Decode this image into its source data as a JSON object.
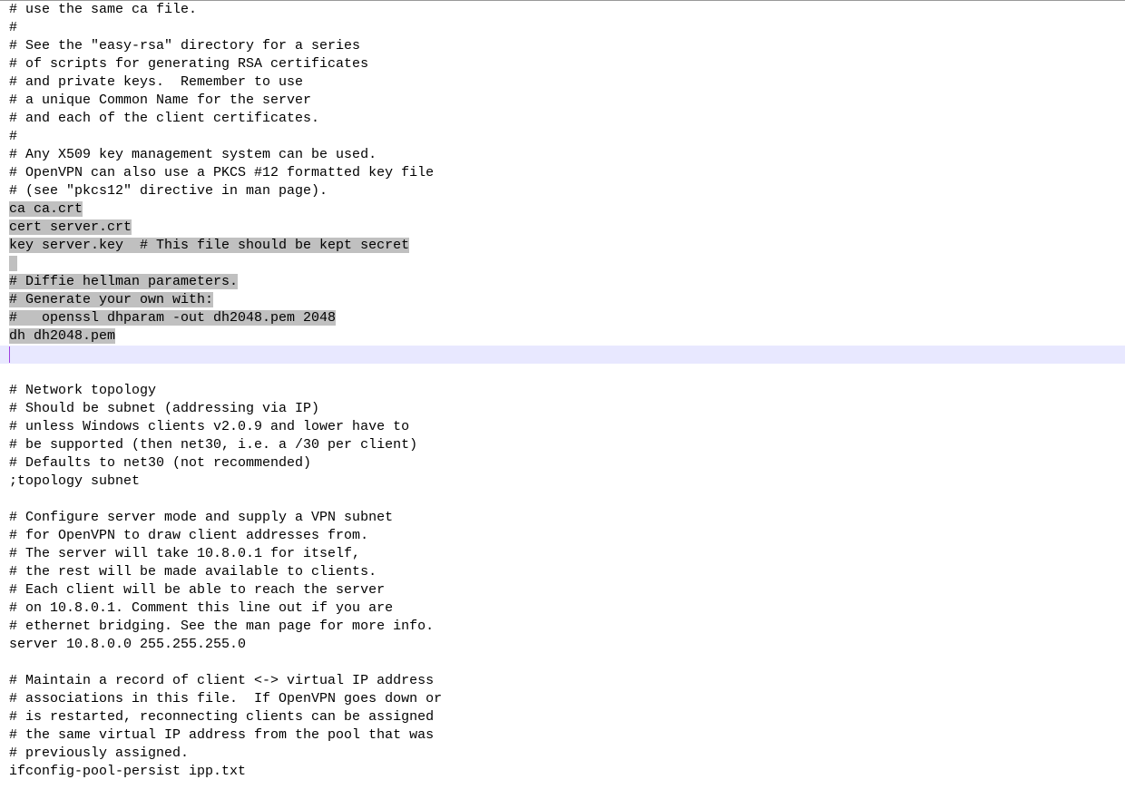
{
  "lines": [
    {
      "t": "# use the same ca file.",
      "sel": false
    },
    {
      "t": "#",
      "sel": false
    },
    {
      "t": "# See the \"easy-rsa\" directory for a series",
      "sel": false
    },
    {
      "t": "# of scripts for generating RSA certificates",
      "sel": false
    },
    {
      "t": "# and private keys.  Remember to use",
      "sel": false
    },
    {
      "t": "# a unique Common Name for the server",
      "sel": false
    },
    {
      "t": "# and each of the client certificates.",
      "sel": false
    },
    {
      "t": "#",
      "sel": false
    },
    {
      "t": "# Any X509 key management system can be used.",
      "sel": false
    },
    {
      "t": "# OpenVPN can also use a PKCS #12 formatted key file",
      "sel": false
    },
    {
      "t": "# (see \"pkcs12\" directive in man page).",
      "sel": false
    },
    {
      "t": "ca ca.crt",
      "sel": true
    },
    {
      "t": "cert server.crt",
      "sel": true
    },
    {
      "t": "key server.key  # This file should be kept secret",
      "sel": true
    },
    {
      "t": " ",
      "sel": true
    },
    {
      "t": "# Diffie hellman parameters.",
      "sel": true
    },
    {
      "t": "# Generate your own with:",
      "sel": true
    },
    {
      "t": "#   openssl dhparam -out dh2048.pem 2048",
      "sel": true
    },
    {
      "t": "dh dh2048.pem",
      "sel": true
    },
    {
      "t": "",
      "sel": false,
      "cursor": true
    },
    {
      "t": "",
      "sel": false
    },
    {
      "t": "# Network topology",
      "sel": false
    },
    {
      "t": "# Should be subnet (addressing via IP)",
      "sel": false
    },
    {
      "t": "# unless Windows clients v2.0.9 and lower have to",
      "sel": false
    },
    {
      "t": "# be supported (then net30, i.e. a /30 per client)",
      "sel": false
    },
    {
      "t": "# Defaults to net30 (not recommended)",
      "sel": false
    },
    {
      "t": ";topology subnet",
      "sel": false
    },
    {
      "t": "",
      "sel": false
    },
    {
      "t": "# Configure server mode and supply a VPN subnet",
      "sel": false
    },
    {
      "t": "# for OpenVPN to draw client addresses from.",
      "sel": false
    },
    {
      "t": "# The server will take 10.8.0.1 for itself,",
      "sel": false
    },
    {
      "t": "# the rest will be made available to clients.",
      "sel": false
    },
    {
      "t": "# Each client will be able to reach the server",
      "sel": false
    },
    {
      "t": "# on 10.8.0.1. Comment this line out if you are",
      "sel": false
    },
    {
      "t": "# ethernet bridging. See the man page for more info.",
      "sel": false
    },
    {
      "t": "server 10.8.0.0 255.255.255.0",
      "sel": false
    },
    {
      "t": "",
      "sel": false
    },
    {
      "t": "# Maintain a record of client <-> virtual IP address",
      "sel": false
    },
    {
      "t": "# associations in this file.  If OpenVPN goes down or",
      "sel": false
    },
    {
      "t": "# is restarted, reconnecting clients can be assigned",
      "sel": false
    },
    {
      "t": "# the same virtual IP address from the pool that was",
      "sel": false
    },
    {
      "t": "# previously assigned.",
      "sel": false
    },
    {
      "t": "ifconfig-pool-persist ipp.txt",
      "sel": false
    },
    {
      "t": "",
      "sel": false
    }
  ]
}
